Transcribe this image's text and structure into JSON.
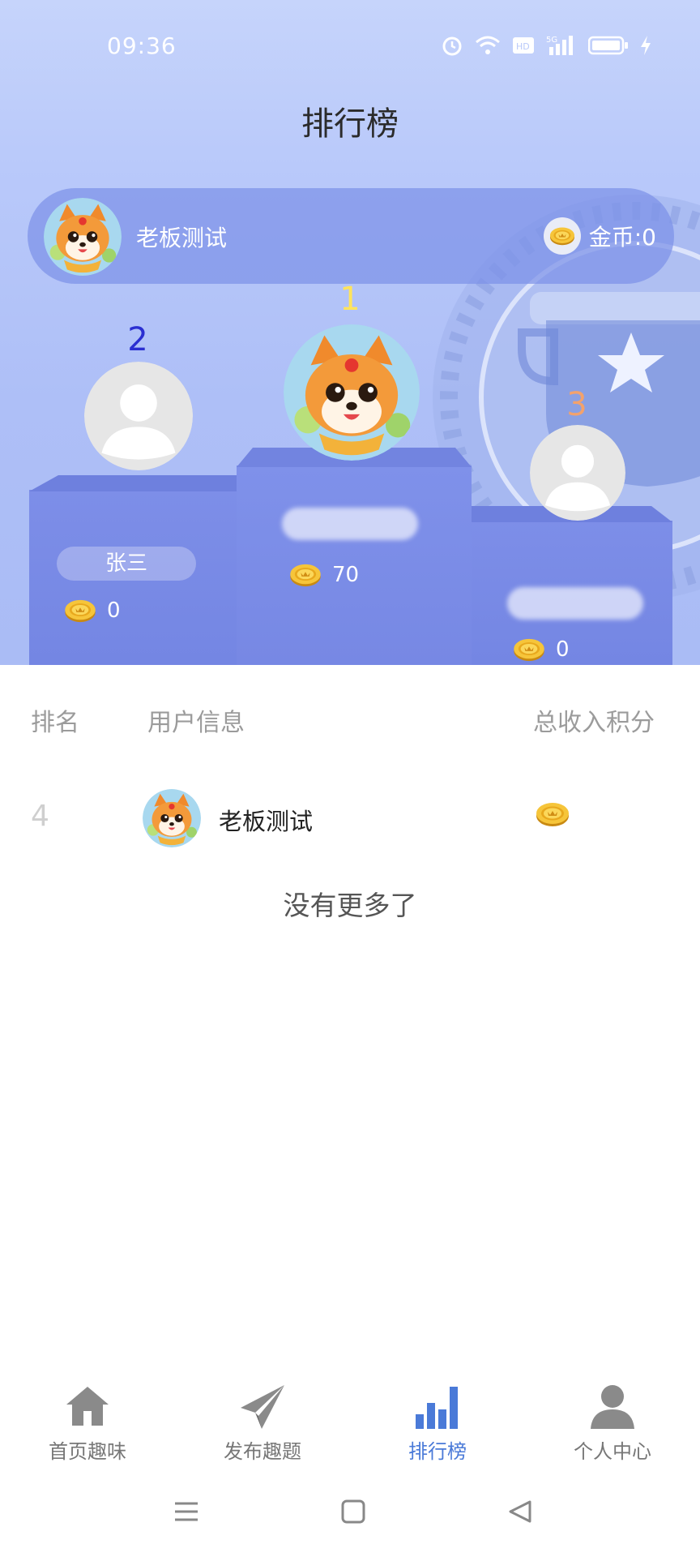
{
  "status_bar": {
    "time": "09:36"
  },
  "header": {
    "title": "排行榜"
  },
  "me": {
    "name": "老板测试",
    "coins_label": "金币:0"
  },
  "podium": [
    {
      "rank": "1",
      "name_visible": false,
      "coins": "70",
      "rank_color": "#ffe45c"
    },
    {
      "rank": "2",
      "name": "张三",
      "coins": "0",
      "rank_color": "#2b2fd1"
    },
    {
      "rank": "3",
      "name_visible": false,
      "coins": "0",
      "rank_color": "#f3a26c"
    }
  ],
  "list": {
    "headers": {
      "rank": "排名",
      "user": "用户信息",
      "score": "总收入积分"
    },
    "rows": [
      {
        "rank": "4",
        "name": "老板测试"
      }
    ],
    "footer": "没有更多了"
  },
  "tabs": [
    {
      "label": "首页趣味",
      "icon": "home-icon",
      "active": false
    },
    {
      "label": "发布趣题",
      "icon": "paper-plane-icon",
      "active": false
    },
    {
      "label": "排行榜",
      "icon": "bar-chart-icon",
      "active": true
    },
    {
      "label": "个人中心",
      "icon": "person-icon",
      "active": false
    }
  ],
  "colors": {
    "accent": "#4a7ad8",
    "podium": "#7a8be6",
    "hero_bg": "#b9c9fa"
  }
}
